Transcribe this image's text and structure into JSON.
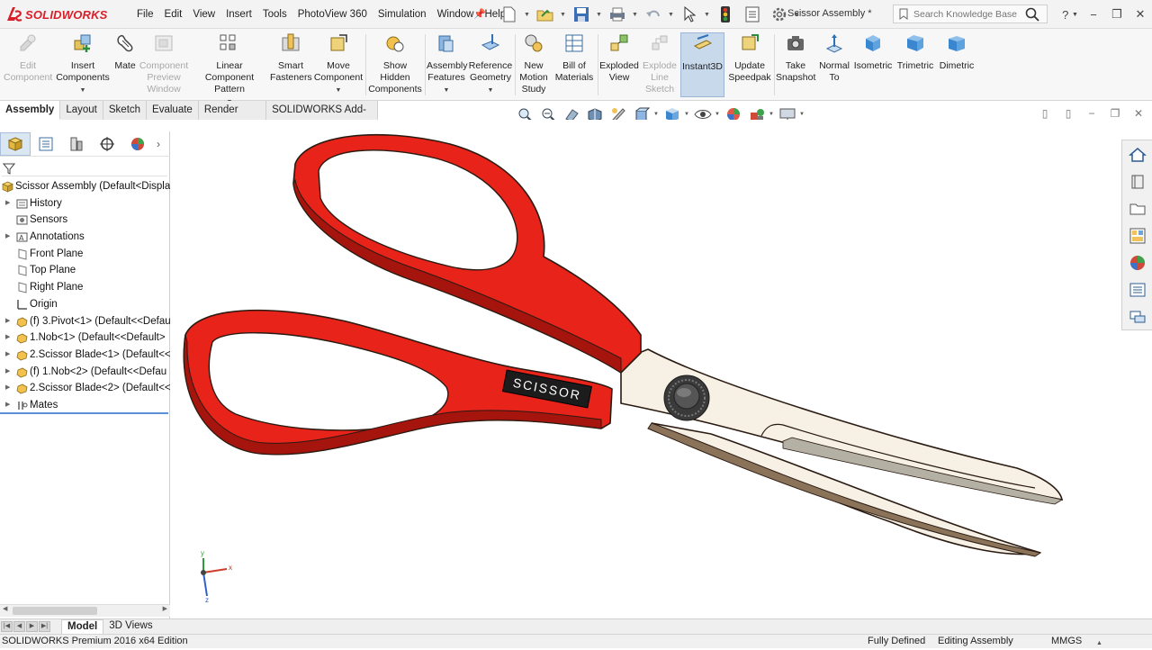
{
  "app": {
    "logo_text": "SOLIDWORKS",
    "document_title": "Scissor Assembly *",
    "menu": [
      "File",
      "Edit",
      "View",
      "Insert",
      "Tools",
      "PhotoView 360",
      "Simulation",
      "Window",
      "Help"
    ],
    "search_placeholder": "Search Knowledge Base",
    "help_label": "?"
  },
  "ribbon": {
    "buttons": [
      {
        "label": "Edit Component",
        "icon": "edit-component-icon",
        "enabled": false
      },
      {
        "label": "Insert Components",
        "icon": "insert-components-icon",
        "enabled": true
      },
      {
        "label": "Mate",
        "icon": "mate-icon",
        "enabled": true
      },
      {
        "label": "Component Preview Window",
        "icon": "component-preview-icon",
        "enabled": false
      },
      {
        "label": "Linear Component Pattern",
        "icon": "linear-pattern-icon",
        "enabled": true
      },
      {
        "label": "Smart Fasteners",
        "icon": "smart-fasteners-icon",
        "enabled": true
      },
      {
        "label": "Move Component",
        "icon": "move-component-icon",
        "enabled": true
      },
      {
        "label": "Show Hidden Components",
        "icon": "show-hidden-icon",
        "enabled": true
      },
      {
        "label": "Assembly Features",
        "icon": "assembly-features-icon",
        "enabled": true
      },
      {
        "label": "Reference Geometry",
        "icon": "reference-geometry-icon",
        "enabled": true
      },
      {
        "label": "New Motion Study",
        "icon": "motion-study-icon",
        "enabled": true
      },
      {
        "label": "Bill of Materials",
        "icon": "bill-of-materials-icon",
        "enabled": true
      },
      {
        "label": "Exploded View",
        "icon": "exploded-view-icon",
        "enabled": true
      },
      {
        "label": "Explode Line Sketch",
        "icon": "explode-line-icon",
        "enabled": false
      },
      {
        "label": "Instant3D",
        "icon": "instant3d-icon",
        "enabled": true,
        "active": true
      },
      {
        "label": "Update Speedpak",
        "icon": "speedpak-icon",
        "enabled": true
      },
      {
        "label": "Take Snapshot",
        "icon": "camera-icon",
        "enabled": true
      },
      {
        "label": "Normal To",
        "icon": "normal-to-icon",
        "enabled": true
      },
      {
        "label": "Isometric",
        "icon": "isometric-icon",
        "enabled": true
      },
      {
        "label": "Trimetric",
        "icon": "trimetric-icon",
        "enabled": true
      },
      {
        "label": "Dimetric",
        "icon": "dimetric-icon",
        "enabled": true
      }
    ]
  },
  "tabs": [
    "Assembly",
    "Layout",
    "Sketch",
    "Evaluate",
    "Render Tools",
    "SOLIDWORKS Add-Ins"
  ],
  "tree": {
    "root": "Scissor Assembly  (Default<Displa",
    "items": [
      {
        "label": "History",
        "icon": "history-folder-icon",
        "expandable": true
      },
      {
        "label": "Sensors",
        "icon": "sensors-icon",
        "expandable": false
      },
      {
        "label": "Annotations",
        "icon": "annotations-icon",
        "expandable": true
      },
      {
        "label": "Front Plane",
        "icon": "plane-icon",
        "expandable": false
      },
      {
        "label": "Top Plane",
        "icon": "plane-icon",
        "expandable": false
      },
      {
        "label": "Right Plane",
        "icon": "plane-icon",
        "expandable": false
      },
      {
        "label": "Origin",
        "icon": "origin-icon",
        "expandable": false
      },
      {
        "label": "(f) 3.Pivot<1> (Default<<Defau",
        "icon": "part-icon",
        "expandable": true
      },
      {
        "label": "1.Nob<1> (Default<<Default>",
        "icon": "part-icon",
        "expandable": true
      },
      {
        "label": "2.Scissor Blade<1> (Default<<",
        "icon": "part-icon",
        "expandable": true
      },
      {
        "label": "(f) 1.Nob<2> (Default<<Defau",
        "icon": "part-icon",
        "expandable": true
      },
      {
        "label": "2.Scissor Blade<2> (Default<<",
        "icon": "part-icon",
        "expandable": true
      },
      {
        "label": "Mates",
        "icon": "mates-icon",
        "expandable": true
      }
    ]
  },
  "model": {
    "handle_label": "SCISSOR",
    "colors": {
      "handle": "#e8231a",
      "blade": "#f6f1e4",
      "edge": "#2a1a12"
    }
  },
  "bottom_tabs": [
    "Model",
    "3D Views"
  ],
  "status": {
    "edition": "SOLIDWORKS Premium 2016 x64 Edition",
    "definition": "Fully Defined",
    "mode": "Editing Assembly",
    "units": "MMGS"
  },
  "triad": {
    "x_label": "x",
    "y_label": "y",
    "z_label": "z"
  }
}
